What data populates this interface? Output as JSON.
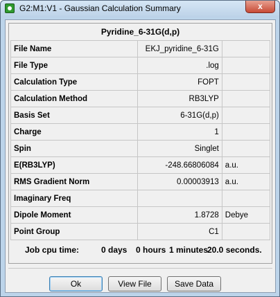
{
  "window": {
    "title": "G2:M1:V1 - Gaussian Calculation Summary",
    "close_glyph": "x"
  },
  "summary": {
    "title": "Pyridine_6-31G(d,p)",
    "rows": [
      {
        "label": "File Name",
        "value": "EKJ_pyridine_6-31G",
        "unit": ""
      },
      {
        "label": "File Type",
        "value": ".log",
        "unit": ""
      },
      {
        "label": "Calculation Type",
        "value": "FOPT",
        "unit": ""
      },
      {
        "label": "Calculation Method",
        "value": "RB3LYP",
        "unit": ""
      },
      {
        "label": "Basis Set",
        "value": "6-31G(d,p)",
        "unit": ""
      },
      {
        "label": "Charge",
        "value": "1",
        "unit": ""
      },
      {
        "label": "Spin",
        "value": "Singlet",
        "unit": ""
      },
      {
        "label": "E(RB3LYP)",
        "value": "-248.66806084",
        "unit": "a.u."
      },
      {
        "label": "RMS Gradient Norm",
        "value": "0.00003913",
        "unit": "a.u."
      },
      {
        "label": "Imaginary Freq",
        "value": "",
        "unit": ""
      },
      {
        "label": "Dipole Moment",
        "value": "1.8728",
        "unit": "Debye"
      },
      {
        "label": "Point Group",
        "value": "C1",
        "unit": ""
      }
    ],
    "cpu_time": {
      "label": "Job cpu time:",
      "days": "0 days",
      "hours": "0 hours",
      "minutes": "1 minutes",
      "seconds": "20.0 seconds."
    }
  },
  "buttons": {
    "ok": "Ok",
    "view_file": "View File",
    "save_data": "Save Data"
  }
}
